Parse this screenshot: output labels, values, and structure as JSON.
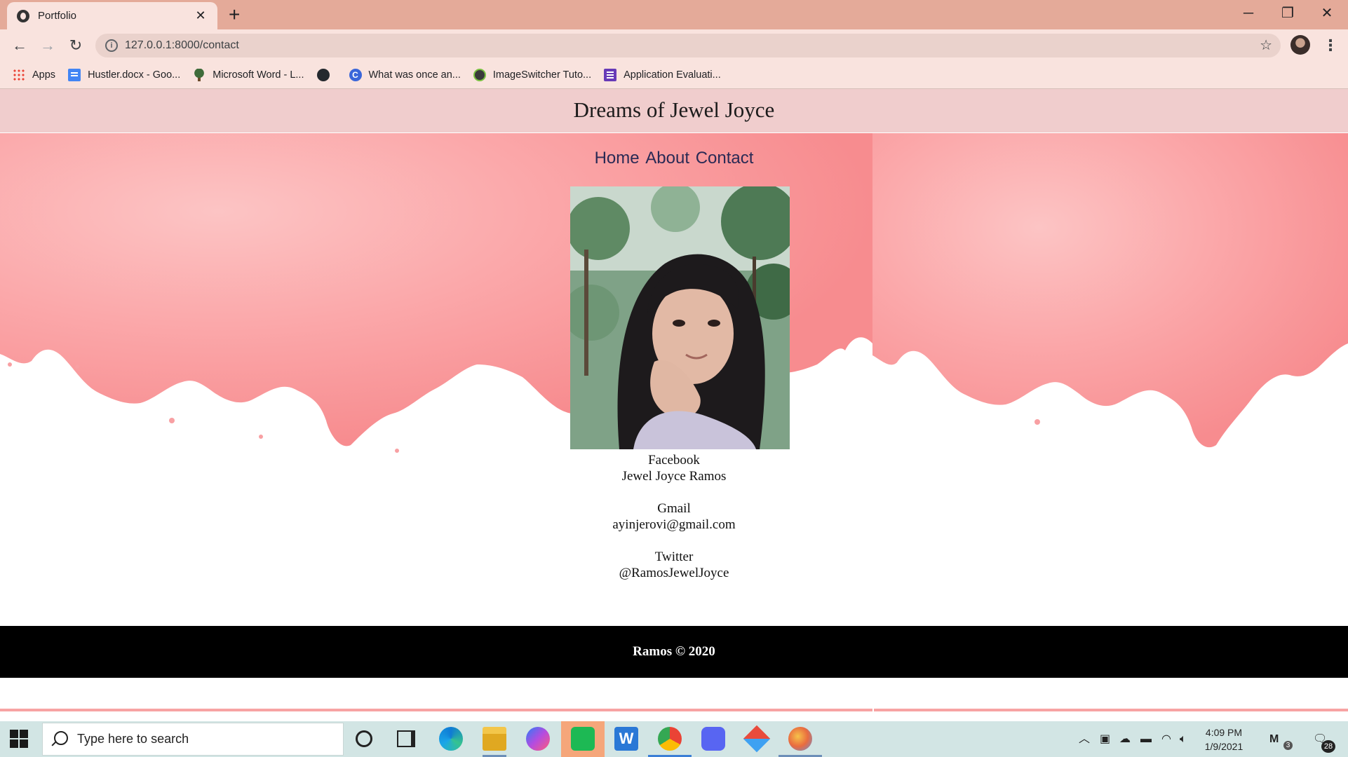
{
  "browser": {
    "tab_title": "Portfolio",
    "tab_close": "✕",
    "new_tab": "+",
    "url": "127.0.0.1:8000/contact",
    "nav": {
      "back": "←",
      "forward": "→",
      "reload": "↻"
    },
    "window": {
      "minimize": "─",
      "restore": "❐",
      "close": "✕"
    },
    "bookmarks": [
      {
        "label": "Apps",
        "icon": "apps-grid-icon"
      },
      {
        "label": "Hustler.docx - Goo...",
        "icon": "google-docs-icon"
      },
      {
        "label": "Microsoft Word - L...",
        "icon": "tree-icon"
      },
      {
        "label": "",
        "icon": "github-icon"
      },
      {
        "label": "What was once an...",
        "icon": "c-letter-icon"
      },
      {
        "label": "ImageSwitcher Tuto...",
        "icon": "gear-badge-icon"
      },
      {
        "label": "Application Evaluati...",
        "icon": "google-forms-icon"
      }
    ]
  },
  "site": {
    "title": "Dreams of Jewel Joyce",
    "nav": [
      "Home",
      "About",
      "Contact"
    ],
    "contacts": [
      {
        "label": "Facebook",
        "value": "Jewel Joyce Ramos"
      },
      {
        "label": "Gmail",
        "value": "ayinjerovi@gmail.com"
      },
      {
        "label": "Twitter",
        "value": "@RamosJewelJoyce"
      }
    ],
    "footer": "Ramos © 2020"
  },
  "taskbar": {
    "search_placeholder": "Type here to search",
    "time": "4:09 PM",
    "date": "1/9/2021",
    "notification_count": "28",
    "mail_count": "3"
  },
  "colors": {
    "accent_pink": "#f7a3a3",
    "header_pink": "#f0cdcd",
    "chrome_tab": "#e4aa99",
    "footer": "#000000"
  }
}
